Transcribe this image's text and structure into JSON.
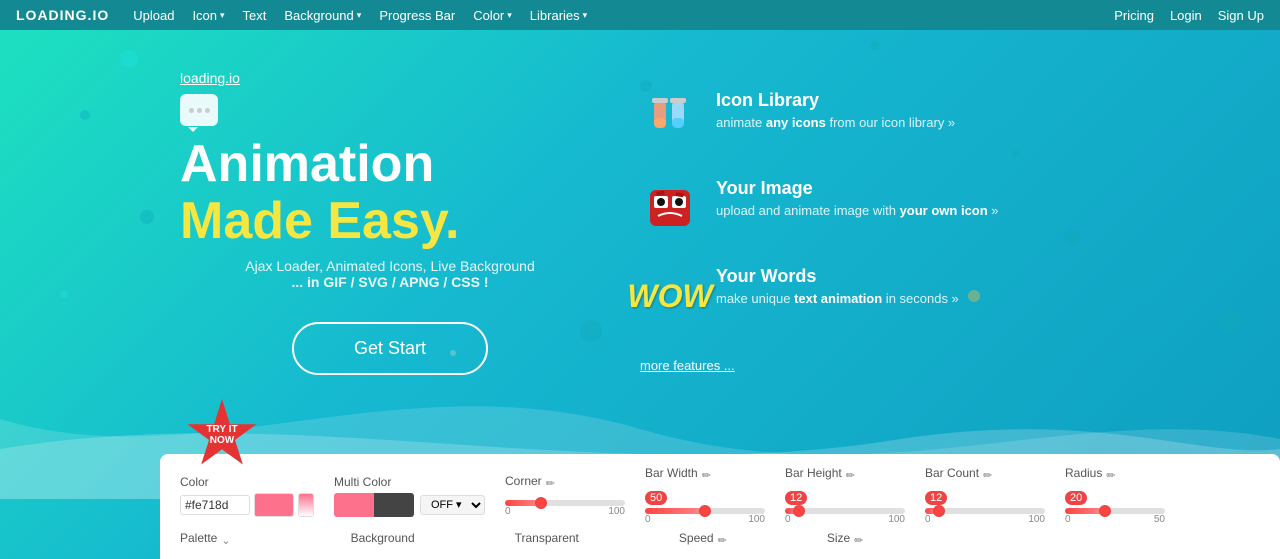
{
  "nav": {
    "logo": "LOADING.IO",
    "links": [
      {
        "label": "Upload",
        "hasDropdown": false
      },
      {
        "label": "Icon",
        "hasDropdown": true
      },
      {
        "label": "Text",
        "hasDropdown": false
      },
      {
        "label": "Background",
        "hasDropdown": true
      },
      {
        "label": "Progress Bar",
        "hasDropdown": false
      },
      {
        "label": "Color",
        "hasDropdown": true
      },
      {
        "label": "Libraries",
        "hasDropdown": true
      }
    ],
    "right": [
      {
        "label": "Pricing"
      },
      {
        "label": "Login"
      },
      {
        "label": "Sign Up"
      }
    ]
  },
  "hero": {
    "site_link": "loading.io",
    "title_line1": "Animation",
    "title_line2": "Made Easy.",
    "subtitle": "Ajax Loader, Animated Icons, Live Background",
    "formats": "... in GIF / SVG / APNG / CSS !",
    "cta": "Get Start"
  },
  "features": [
    {
      "id": "icon-library",
      "title": "Icon Library",
      "desc_pre": "animate ",
      "desc_bold": "any icons",
      "desc_post": " from our icon library »"
    },
    {
      "id": "your-image",
      "title": "Your Image",
      "desc_pre": "upload and animate image with ",
      "desc_bold": "your own icon",
      "desc_post": " »"
    },
    {
      "id": "your-words",
      "title": "Your Words",
      "desc_pre": "make unique ",
      "desc_bold": "text animation",
      "desc_post": " in seconds »"
    }
  ],
  "more_features": "more features ...",
  "panel": {
    "color_label": "Color",
    "color_value": "#fe718d",
    "multi_color_label": "Multi Color",
    "multi_off": "OFF",
    "corner_label": "Corner",
    "bar_width_label": "Bar Width",
    "bar_width_val": "50",
    "bar_width_max": "100",
    "bar_height_label": "Bar Height",
    "bar_height_val": "12",
    "bar_height_max": "100",
    "bar_count_label": "Bar Count",
    "bar_count_val": "12",
    "bar_count_max": "100",
    "radius_label": "Radius",
    "radius_val": "20",
    "radius_max": "50",
    "palette_label": "Palette",
    "background_label": "Background",
    "transparent_label": "Transparent",
    "speed_label": "Speed",
    "size_label": "Size"
  },
  "try_badge": {
    "line1": "TRY IT",
    "line2": "NOW"
  }
}
